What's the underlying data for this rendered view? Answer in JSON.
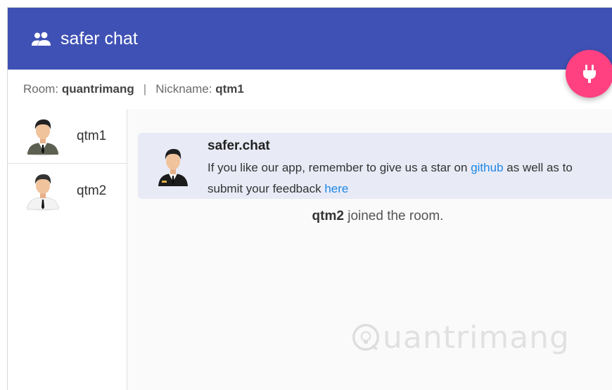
{
  "header": {
    "title": "safer chat",
    "icon": "group-icon",
    "color": "#3f51b5"
  },
  "fab": {
    "icon": "plug-icon",
    "color": "#ff4081"
  },
  "info": {
    "room_label": "Room:",
    "room_value": "quantrimang",
    "separator": "|",
    "nickname_label": "Nickname:",
    "nickname_value": "qtm1"
  },
  "users": [
    {
      "name": "qtm1",
      "icon": "user-avatar-icon"
    },
    {
      "name": "qtm2",
      "icon": "user-avatar-icon"
    }
  ],
  "messages": [
    {
      "sender": "safer.chat",
      "text_part1": "If you like our app, remember to give us a star on",
      "link1": "github",
      "text_part2": "as well as to submit your feedback",
      "link2": "here",
      "icon": "bot-avatar-icon"
    }
  ],
  "events": [
    {
      "user": "qtm2",
      "text": "joined the room."
    }
  ],
  "watermark": {
    "text": "uantrimang"
  }
}
